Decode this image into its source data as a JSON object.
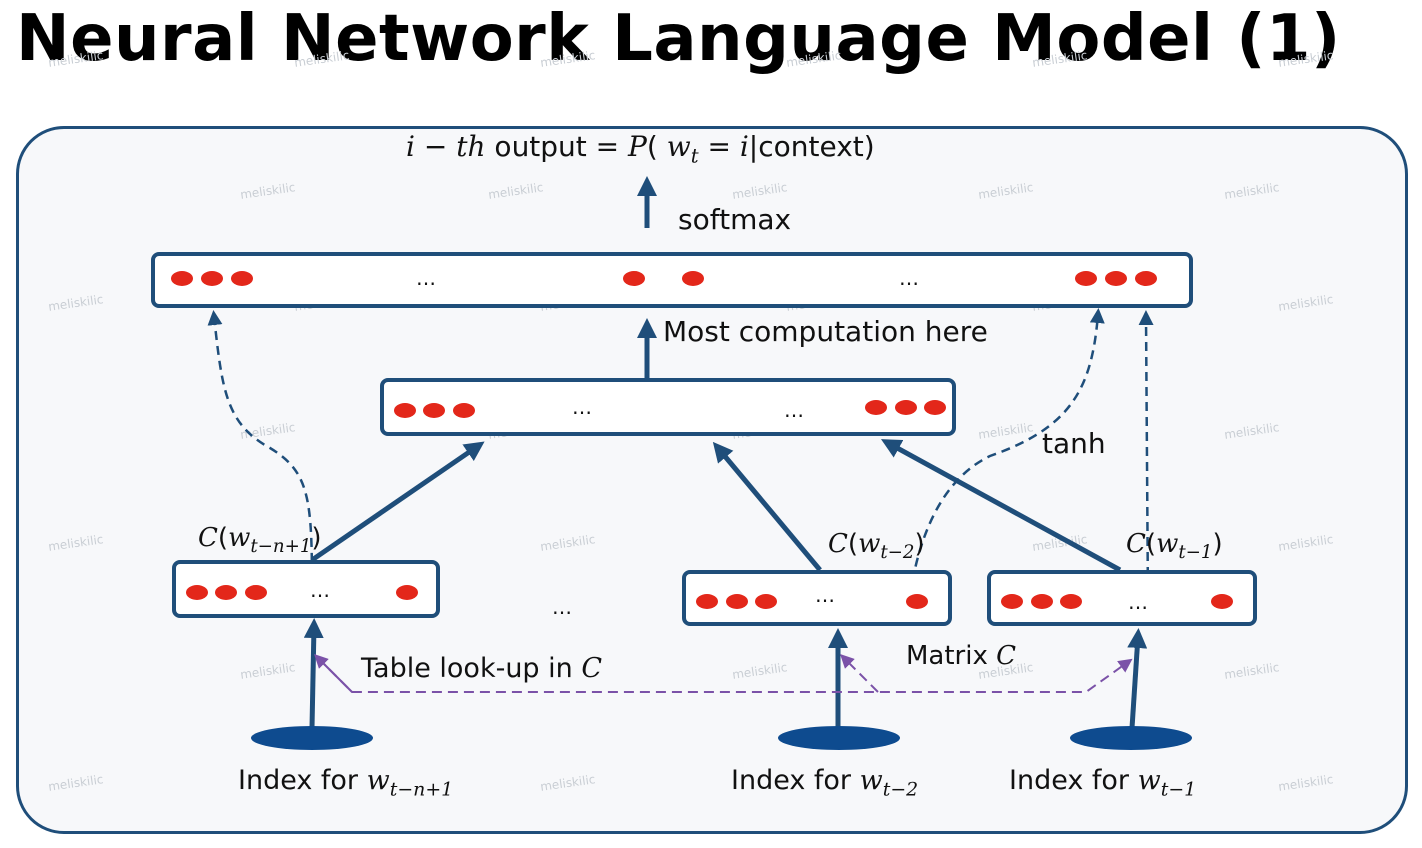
{
  "title": "Neural Network Language Model (1)",
  "output_label": {
    "i": "i",
    "minus": " − ",
    "th": "th",
    "output": " output = ",
    "P": "P",
    "paren": "( ",
    "w": "w",
    "t": "t",
    "eq": " = ",
    "i2": "i",
    "bar_context": "|context)"
  },
  "softmax_label": "softmax",
  "most_computation_label": "Most computation here",
  "tanh_label": "tanh",
  "table_lookup_label": {
    "text": "Table look-up in ",
    "C": "C"
  },
  "matrix_label": {
    "text": "Matrix ",
    "C": "C"
  },
  "ellipsis": "…",
  "embed_labels": [
    {
      "C": "C",
      "open": "(",
      "w": "w",
      "sub": "t−n+1",
      "close": ")"
    },
    {
      "C": "C",
      "open": "(",
      "w": "w",
      "sub": "t−2",
      "close": ")"
    },
    {
      "C": "C",
      "open": "(",
      "w": "w",
      "sub": "t−1",
      "close": ")"
    }
  ],
  "index_labels": [
    {
      "text": "Index for ",
      "w": "w",
      "sub": "t−n+1"
    },
    {
      "text": "Index for ",
      "w": "w",
      "sub": "t−2"
    },
    {
      "text": "Index for ",
      "w": "w",
      "sub": "t−1"
    }
  ],
  "watermark": "meliskilic",
  "colors": {
    "box_border": "#1f4e7a",
    "dot": "#e3271a",
    "arrow": "#1f4e7a",
    "lookup_dash": "#7b52a8",
    "oval": "#0e4b8f"
  }
}
